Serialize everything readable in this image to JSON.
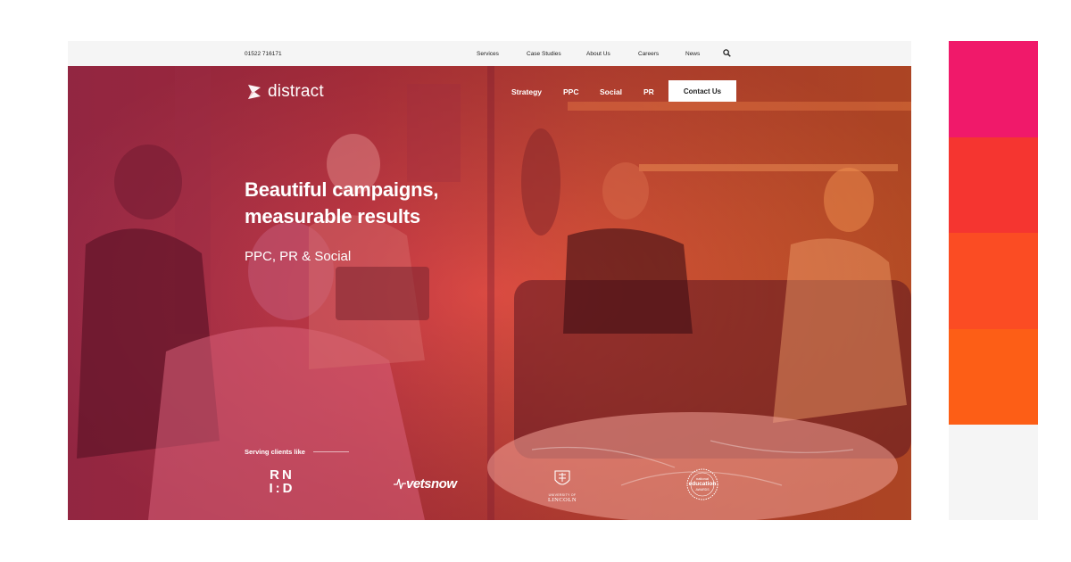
{
  "topbar": {
    "phone": "01522 716171",
    "nav": [
      "Services",
      "Case Studies",
      "About Us",
      "Careers",
      "News"
    ],
    "search_icon": "search-icon"
  },
  "header": {
    "logo_text": "distract",
    "logo_icon": "distract-logo-mark",
    "nav": [
      "Strategy",
      "PPC",
      "Social",
      "PR"
    ],
    "cta_label": "Contact Us"
  },
  "hero": {
    "headline_line1": "Beautiful campaigns,",
    "headline_line2": "measurable results",
    "subhead": "PPC, PR & Social",
    "serving_label": "Serving clients like"
  },
  "clients": {
    "rnid_line1": "RN",
    "rnid_line2": "I:D",
    "vetsnow": "vetsnow",
    "lincoln_line1": "UNIVERSITY OF",
    "lincoln_line2": "LINCOLN",
    "nea_top": "national",
    "nea_mid": "education",
    "nea_bottom": "AWARDS"
  },
  "palette": {
    "colors": [
      "#f0196a",
      "#f53530",
      "#fb4c23",
      "#fd5e16",
      "#f5f5f5"
    ]
  }
}
